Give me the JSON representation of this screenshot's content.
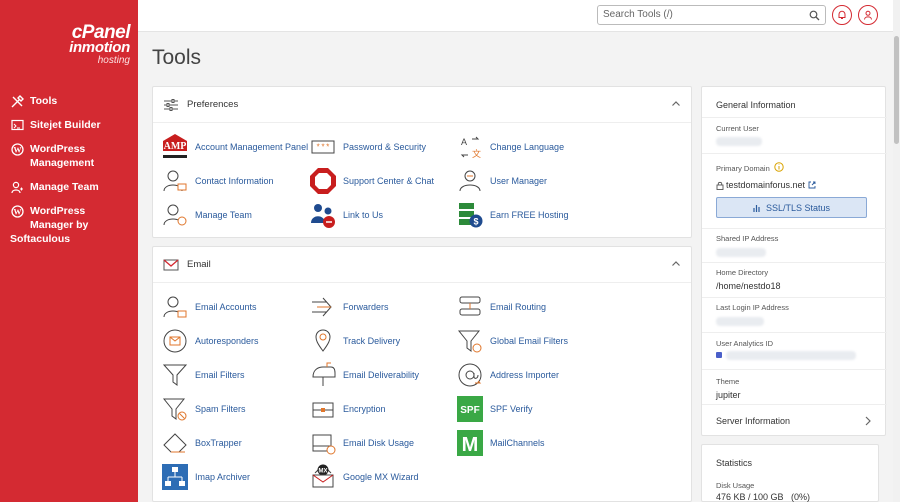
{
  "sidebar": {
    "logo": {
      "cpanel": "cPanel",
      "brand": "inmotion",
      "sub": "hosting"
    },
    "items": [
      {
        "label": "Tools",
        "icon": "tools-icon"
      },
      {
        "label": "Sitejet Builder",
        "icon": "sitejet-icon"
      },
      {
        "label": "WordPress Management",
        "icon": "wordpress-icon"
      },
      {
        "label": "Manage Team",
        "icon": "team-icon"
      },
      {
        "label": "WordPress Manager by Softaculous",
        "icon": "wordpress-icon"
      }
    ],
    "wp_manager_line1": "WordPress",
    "wp_manager_line2": "Manager by",
    "wp_manager_line3": "Softaculous",
    "wp_mgmt_line1": "WordPress",
    "wp_mgmt_line2": "Management"
  },
  "topbar": {
    "search_placeholder": "Search Tools (/)"
  },
  "page": {
    "title": "Tools"
  },
  "preferences": {
    "title": "Preferences",
    "tools": [
      "Account Management Panel",
      "Password & Security",
      "Change Language",
      "Contact Information",
      "Support Center & Chat",
      "User Manager",
      "Manage Team",
      "Link to Us",
      "Earn FREE Hosting"
    ]
  },
  "email": {
    "title": "Email",
    "tools": [
      "Email Accounts",
      "Forwarders",
      "Email Routing",
      "Autoresponders",
      "Track Delivery",
      "Global Email Filters",
      "Email Filters",
      "Email Deliverability",
      "Address Importer",
      "Spam Filters",
      "Encryption",
      "SPF Verify",
      "BoxTrapper",
      "Email Disk Usage",
      "MailChannels",
      "Imap Archiver",
      "Google MX Wizard"
    ]
  },
  "general_info": {
    "title": "General Information",
    "current_user_label": "Current User",
    "primary_domain_label": "Primary Domain",
    "primary_domain": "testdomainforus.net",
    "ssl_button": "SSL/TLS Status",
    "shared_ip_label": "Shared IP Address",
    "home_dir_label": "Home Directory",
    "home_dir": "/home/nestdo18",
    "last_login_label": "Last Login IP Address",
    "analytics_label": "User Analytics ID",
    "theme_label": "Theme",
    "theme": "jupiter",
    "server_info": "Server Information"
  },
  "statistics": {
    "title": "Statistics",
    "disk_usage_label": "Disk Usage",
    "disk_usage_value": "476 KB / 100 GB   (0%)"
  },
  "colors": {
    "brand": "#d42a32",
    "link": "#2a5a9c"
  }
}
